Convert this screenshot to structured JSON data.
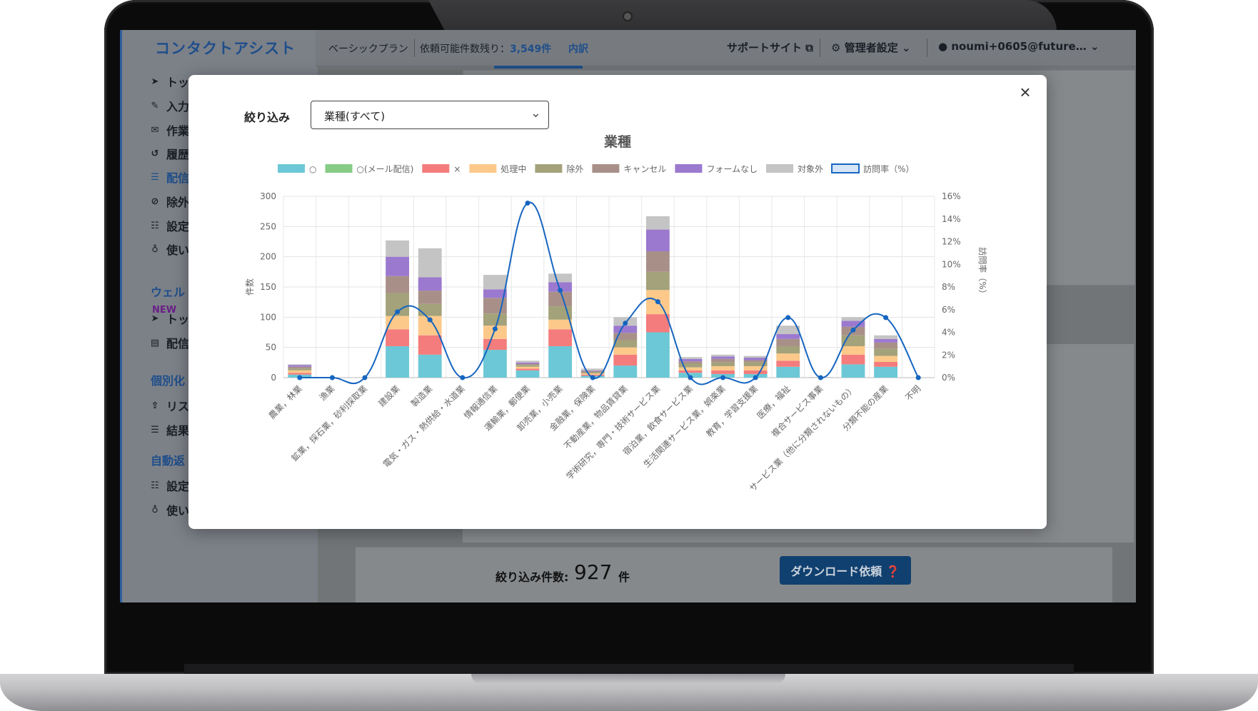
{
  "app": {
    "brand": "コンタクトアシスト"
  },
  "topbar": {
    "plan": "ベーシックプラン",
    "remaining_label": "依頼可能件数残り：",
    "remaining_value": "3,549件",
    "breakdown": "内訳",
    "support": "サポートサイト",
    "admin": "管理者設定",
    "user": "noumi+0605@future…"
  },
  "sidebar": {
    "items": [
      {
        "label": "トッ",
        "icon": "send-icon"
      },
      {
        "label": "入力",
        "icon": "edit-icon"
      },
      {
        "label": "作業",
        "icon": "mail-icon"
      },
      {
        "label": "履歴",
        "icon": "history-icon"
      },
      {
        "label": "配信",
        "icon": "list-icon"
      },
      {
        "label": "除外",
        "icon": "block-icon"
      },
      {
        "label": "設定",
        "icon": "sliders-icon"
      },
      {
        "label": "使い",
        "icon": "bulb-icon"
      }
    ],
    "new_badge": "NEW",
    "section_welcome": "ウェル",
    "welcome_items": [
      {
        "label": "トッ",
        "icon": "send-icon"
      },
      {
        "label": "配信",
        "icon": "newspaper-icon"
      }
    ],
    "section_personal": "個別化",
    "personal_items": [
      {
        "label": "リス",
        "icon": "upload-file-icon"
      },
      {
        "label": "結果",
        "icon": "list-icon"
      }
    ],
    "section_auto": "自動返",
    "auto_items": [
      {
        "label": "設定",
        "icon": "sliders-icon"
      },
      {
        "label": "使い方",
        "icon": "bulb-icon"
      }
    ]
  },
  "bottom": {
    "filter_count_label": "絞り込み件数:",
    "filter_count_value": "927",
    "filter_count_unit": "件",
    "download_button": "ダウンロード依頼"
  },
  "modal": {
    "filter_label": "絞り込み",
    "filter_value": "業種(すべて)",
    "close": "×"
  },
  "colors": {
    "accent": "#1f4e8a",
    "line": "#1565c0"
  },
  "chart_data": {
    "type": "bar",
    "stacked": true,
    "title": "業種",
    "ylabel": "件数",
    "y2label": "訪問率（%）",
    "ylim": [
      0,
      300
    ],
    "y2lim": [
      0,
      16
    ],
    "yticks": [
      "0",
      "50",
      "100",
      "150",
      "200",
      "250",
      "300"
    ],
    "y2ticks": [
      "0%",
      "2%",
      "4%",
      "6%",
      "8%",
      "10%",
      "12%",
      "14%",
      "16%"
    ],
    "categories": [
      "農業，林業",
      "漁業",
      "鉱業，採石業，砂利採取業",
      "建設業",
      "製造業",
      "電気・ガス・熱供給・水道業",
      "情報通信業",
      "運輸業，郵便業",
      "卸売業，小売業",
      "金融業，保険業",
      "不動産業，物品賃貸業",
      "学術研究，専門・技術サービス業",
      "宿泊業，飲食サービス業",
      "生活関連サービス業，娯楽業",
      "教育，学習支援業",
      "医療，福祉",
      "複合サービス事業",
      "サービス業（他に分類されないもの）",
      "分類不能の産業",
      "不明"
    ],
    "series": [
      {
        "name": "○",
        "color": "#6cc8d6",
        "values": [
          5,
          0,
          0,
          52,
          38,
          0,
          46,
          12,
          52,
          3,
          20,
          75,
          8,
          6,
          6,
          18,
          0,
          22,
          18,
          0
        ]
      },
      {
        "name": "○(メール配信)",
        "color": "#86cc86",
        "values": [
          0,
          0,
          0,
          0,
          0,
          0,
          0,
          0,
          0,
          0,
          0,
          0,
          0,
          0,
          0,
          0,
          0,
          0,
          0,
          0
        ]
      },
      {
        "name": "×",
        "color": "#f47c7c",
        "values": [
          3,
          0,
          0,
          28,
          32,
          0,
          18,
          3,
          28,
          2,
          18,
          30,
          4,
          6,
          6,
          10,
          0,
          16,
          8,
          0
        ]
      },
      {
        "name": "処理中",
        "color": "#fcc98a",
        "values": [
          4,
          0,
          0,
          22,
          32,
          0,
          22,
          3,
          16,
          2,
          12,
          40,
          5,
          7,
          7,
          12,
          0,
          14,
          10,
          0
        ]
      },
      {
        "name": "除外",
        "color": "#a3a27a",
        "values": [
          3,
          0,
          0,
          38,
          20,
          0,
          20,
          3,
          22,
          2,
          12,
          30,
          6,
          6,
          6,
          12,
          0,
          18,
          12,
          0
        ]
      },
      {
        "name": "キャンセル",
        "color": "#a89088",
        "values": [
          3,
          0,
          0,
          28,
          22,
          0,
          26,
          2,
          24,
          2,
          12,
          34,
          4,
          6,
          4,
          12,
          0,
          14,
          10,
          0
        ]
      },
      {
        "name": "フォームなし",
        "color": "#9b79cf",
        "values": [
          3,
          0,
          0,
          32,
          22,
          0,
          14,
          2,
          16,
          1,
          12,
          36,
          4,
          4,
          4,
          8,
          0,
          10,
          6,
          0
        ]
      },
      {
        "name": "対象外",
        "color": "#c4c4c4",
        "values": [
          1,
          0,
          0,
          27,
          48,
          1,
          24,
          3,
          14,
          3,
          14,
          22,
          3,
          3,
          3,
          14,
          1,
          6,
          6,
          0
        ]
      }
    ],
    "line": {
      "name": "訪問率（%）",
      "color": "#1565c0",
      "values": [
        0,
        0,
        0,
        5.8,
        5.1,
        0,
        4.3,
        15.4,
        7.7,
        0,
        4.8,
        6.7,
        0,
        0,
        0,
        5.3,
        0,
        4.2,
        5.3,
        0
      ]
    },
    "legend": "top"
  }
}
